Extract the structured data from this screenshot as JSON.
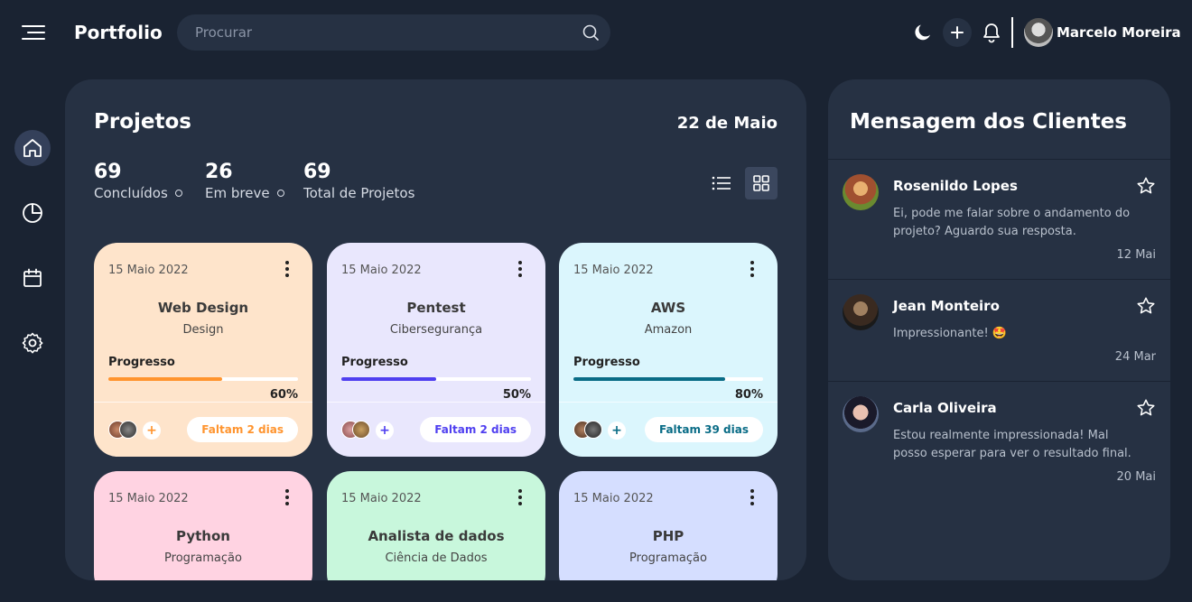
{
  "header": {
    "app_title": "Portfolio",
    "search_placeholder": "Procurar",
    "user_name": "Marcelo Moreira"
  },
  "sidebar": {
    "items": [
      {
        "icon": "home-icon",
        "active": true
      },
      {
        "icon": "pie-chart-icon",
        "active": false
      },
      {
        "icon": "calendar-icon",
        "active": false
      },
      {
        "icon": "gear-icon",
        "active": false
      }
    ]
  },
  "projects": {
    "title": "Projetos",
    "date": "22 de Maio",
    "stats": [
      {
        "value": "69",
        "label": "Concluídos"
      },
      {
        "value": "26",
        "label": "Em breve"
      },
      {
        "value": "69",
        "label": "Total de Projetos"
      }
    ],
    "cards": [
      {
        "date": "15 Maio 2022",
        "name": "Web Design",
        "category": "Design",
        "progress_label": "Progresso",
        "progress": 60,
        "progress_text": "60%",
        "deadline": "Faltam 2 dias",
        "bg": "#fee4cb",
        "accent": "#ff942e"
      },
      {
        "date": "15 Maio 2022",
        "name": "Pentest",
        "category": "Cibersegurança",
        "progress_label": "Progresso",
        "progress": 50,
        "progress_text": "50%",
        "deadline": "Faltam 2 dias",
        "bg": "#e9e7fd",
        "accent": "#4f3ff0"
      },
      {
        "date": "15 Maio 2022",
        "name": "AWS",
        "category": "Amazon",
        "progress_label": "Progresso",
        "progress": 80,
        "progress_text": "80%",
        "deadline": "Faltam 39 dias",
        "bg": "#dbf6fd",
        "accent": "#096c86"
      },
      {
        "date": "15 Maio 2022",
        "name": "Python",
        "category": "Programação",
        "bg": "#ffd3e2",
        "accent": "#df3670"
      },
      {
        "date": "15 Maio 2022",
        "name": "Analista de dados",
        "category": "Ciência de Dados",
        "bg": "#c8f7dc",
        "accent": "#34c471"
      },
      {
        "date": "15 Maio 2022",
        "name": "PHP",
        "category": "Programação",
        "bg": "#d5deff",
        "accent": "#4067f9"
      }
    ]
  },
  "messages": {
    "title": "Mensagem dos Clientes",
    "items": [
      {
        "name": "Rosenildo Lopes",
        "text": "Ei, pode me falar sobre o andamento do projeto? Aguardo sua resposta.",
        "date": "12 Mai"
      },
      {
        "name": "Jean Monteiro",
        "text": "Impressionante! 🤩",
        "date": "24 Mar"
      },
      {
        "name": "Carla Oliveira",
        "text": "Estou realmente impressionada! Mal posso esperar para ver o resultado final.",
        "date": "20 Mai"
      }
    ]
  }
}
